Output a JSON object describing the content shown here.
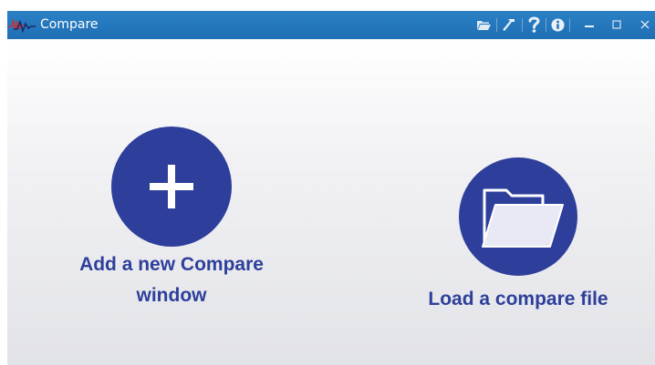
{
  "window": {
    "title": "Compare",
    "app_icon": "waveform-app-icon",
    "title_buttons": [
      {
        "name": "open-folder-button",
        "icon": "folder-icon"
      },
      {
        "name": "tools-button",
        "icon": "hammer-icon"
      },
      {
        "name": "help-button",
        "icon": "question-icon"
      },
      {
        "name": "info-button",
        "icon": "info-icon"
      },
      {
        "name": "minimize-button",
        "icon": "minimize-icon"
      },
      {
        "name": "maximize-button",
        "icon": "maximize-icon"
      },
      {
        "name": "close-button",
        "icon": "close-icon"
      }
    ]
  },
  "actions": {
    "add_compare": {
      "label_line1": "Add a new Compare",
      "label_line2": "window",
      "icon": "plus-icon"
    },
    "load_compare": {
      "label": "Load a compare file",
      "icon": "folder-open-icon"
    }
  },
  "colors": {
    "titlebar": "#1f6fb5",
    "accent": "#2e3f9b",
    "background_top": "#ffffff",
    "background_bottom": "#e2e3e8"
  }
}
